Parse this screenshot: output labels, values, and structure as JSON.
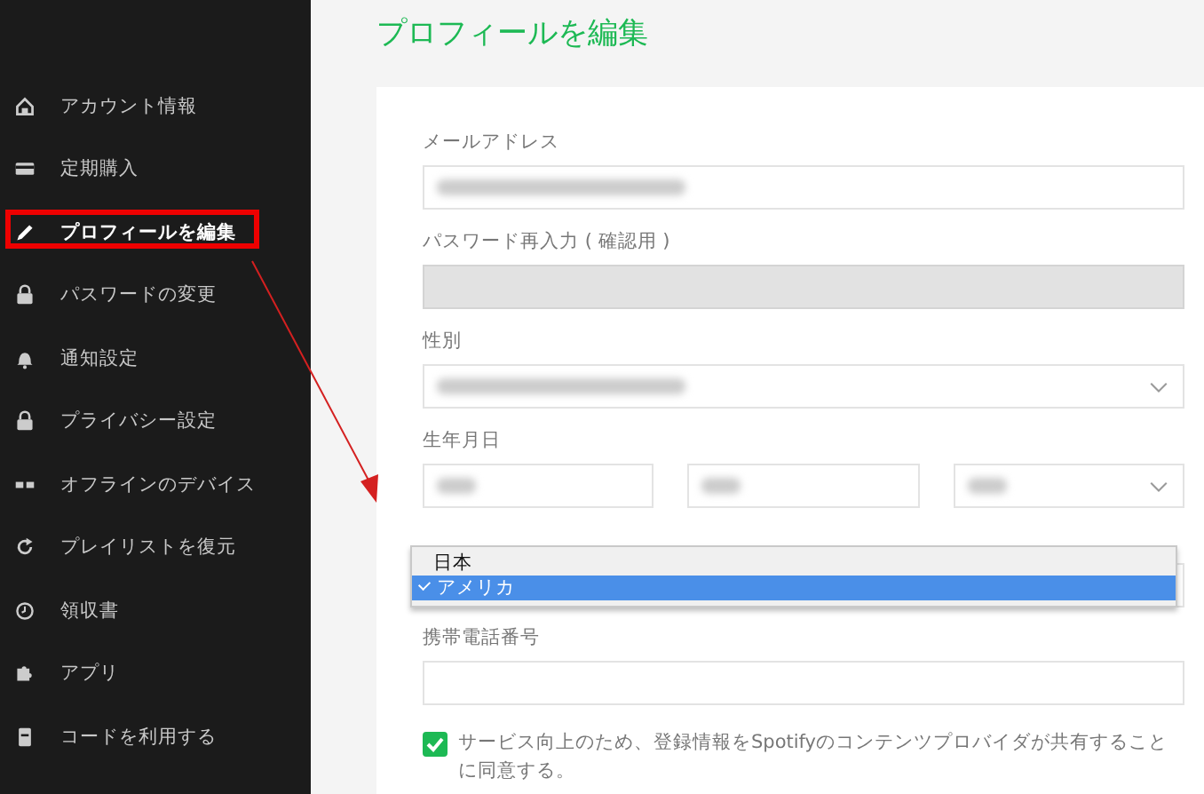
{
  "sidebar": {
    "items": [
      {
        "label": "アカウント情報",
        "kind": "home",
        "selected": false,
        "highlighted": false
      },
      {
        "label": "定期購入",
        "kind": "card",
        "selected": false,
        "highlighted": false
      },
      {
        "label": "プロフィールを編集",
        "kind": "pencil",
        "selected": true,
        "highlighted": true
      },
      {
        "label": "パスワードの変更",
        "kind": "lock",
        "selected": false,
        "highlighted": false
      },
      {
        "label": "通知設定",
        "kind": "bell",
        "selected": false,
        "highlighted": false
      },
      {
        "label": "プライバシー設定",
        "kind": "lock",
        "selected": false,
        "highlighted": false
      },
      {
        "label": "オフラインのデバイス",
        "kind": "devices",
        "selected": false,
        "highlighted": false
      },
      {
        "label": "プレイリストを復元",
        "kind": "restore",
        "selected": false,
        "highlighted": false
      },
      {
        "label": "領収書",
        "kind": "clock",
        "selected": false,
        "highlighted": false
      },
      {
        "label": "アプリ",
        "kind": "puzzle",
        "selected": false,
        "highlighted": false
      },
      {
        "label": "コードを利用する",
        "kind": "code",
        "selected": false,
        "highlighted": false
      }
    ]
  },
  "page": {
    "title": "プロフィールを編集"
  },
  "form": {
    "fields": [
      {
        "kind": "text",
        "label": "メールアドレス",
        "obscured": true,
        "disabled": false
      },
      {
        "kind": "text",
        "label": "パスワード再入力 ( 確認用 )",
        "obscured": false,
        "disabled": true
      },
      {
        "kind": "select",
        "label": "性別",
        "obscured": true,
        "disabled": false
      },
      {
        "kind": "date",
        "label": "生年月日",
        "obscured": true,
        "disabled": false
      },
      {
        "kind": "country",
        "options": [
          {
            "label": "日本",
            "selected": false
          },
          {
            "label": "アメリカ",
            "selected": true
          }
        ]
      },
      {
        "kind": "text",
        "label": "携帯電話番号",
        "obscured": false,
        "disabled": false
      }
    ],
    "consent": {
      "checked": true,
      "text": "サービス向上のため、登録情報をSpotifyのコンテンツプロバイダが共有することに同意する。"
    }
  }
}
